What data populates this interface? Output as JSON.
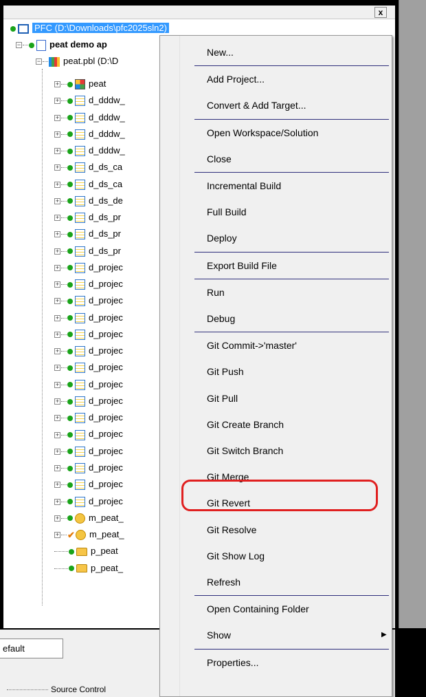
{
  "tree": {
    "workspace_label": "PFC (D:\\Downloads\\pfc2025sln2)",
    "target_label": "peat demo ap",
    "library_label": "peat.pbl (D:\\D",
    "items": [
      {
        "label": "peat",
        "icon": "application-icon",
        "status": "dot"
      },
      {
        "label": "d_dddw_",
        "icon": "datawindow-icon",
        "status": "dot"
      },
      {
        "label": "d_dddw_",
        "icon": "datawindow-icon",
        "status": "dot"
      },
      {
        "label": "d_dddw_",
        "icon": "datawindow-icon",
        "status": "dot"
      },
      {
        "label": "d_dddw_",
        "icon": "datawindow-icon",
        "status": "dot"
      },
      {
        "label": "d_ds_ca",
        "icon": "datawindow-icon",
        "status": "dot"
      },
      {
        "label": "d_ds_ca",
        "icon": "datawindow-icon",
        "status": "dot"
      },
      {
        "label": "d_ds_de",
        "icon": "datawindow-icon",
        "status": "dot"
      },
      {
        "label": "d_ds_pr",
        "icon": "datawindow-icon",
        "status": "dot"
      },
      {
        "label": "d_ds_pr",
        "icon": "datawindow-icon",
        "status": "dot"
      },
      {
        "label": "d_ds_pr",
        "icon": "datawindow-icon",
        "status": "dot"
      },
      {
        "label": "d_projec",
        "icon": "datawindow-icon",
        "status": "dot"
      },
      {
        "label": "d_projec",
        "icon": "datawindow-icon",
        "status": "dot"
      },
      {
        "label": "d_projec",
        "icon": "datawindow-icon",
        "status": "dot"
      },
      {
        "label": "d_projec",
        "icon": "datawindow-icon",
        "status": "dot"
      },
      {
        "label": "d_projec",
        "icon": "datawindow-icon",
        "status": "dot"
      },
      {
        "label": "d_projec",
        "icon": "datawindow-icon",
        "status": "dot"
      },
      {
        "label": "d_projec",
        "icon": "datawindow-icon",
        "status": "dot"
      },
      {
        "label": "d_projec",
        "icon": "datawindow-icon",
        "status": "dot"
      },
      {
        "label": "d_projec",
        "icon": "datawindow-icon",
        "status": "dot"
      },
      {
        "label": "d_projec",
        "icon": "datawindow-icon",
        "status": "dot"
      },
      {
        "label": "d_projec",
        "icon": "datawindow-icon",
        "status": "dot"
      },
      {
        "label": "d_projec",
        "icon": "datawindow-icon",
        "status": "dot"
      },
      {
        "label": "d_projec",
        "icon": "datawindow-icon",
        "status": "dot"
      },
      {
        "label": "d_projec",
        "icon": "datawindow-icon",
        "status": "dot"
      },
      {
        "label": "d_projec",
        "icon": "datawindow-icon",
        "status": "dot"
      },
      {
        "label": "m_peat_",
        "icon": "menu-icon",
        "status": "dot"
      },
      {
        "label": "m_peat_",
        "icon": "menu-icon",
        "status": "check"
      },
      {
        "label": "p_peat",
        "icon": "folder-icon",
        "status": "dot"
      },
      {
        "label": "p_peat_",
        "icon": "folder-icon",
        "status": "dot"
      }
    ]
  },
  "close_glyph": "x",
  "bottom": {
    "tab_label": "efault",
    "source_control_label": "Source Control"
  },
  "context_menu": {
    "items": [
      {
        "label": "New...",
        "sep_after": true
      },
      {
        "label": "Add Project...",
        "sep_after": false
      },
      {
        "label": "Convert & Add Target...",
        "sep_after": true
      },
      {
        "label": "Open Workspace/Solution",
        "sep_after": false
      },
      {
        "label": "Close",
        "sep_after": true
      },
      {
        "label": "Incremental Build",
        "sep_after": false
      },
      {
        "label": "Full Build",
        "sep_after": false
      },
      {
        "label": "Deploy",
        "sep_after": true
      },
      {
        "label": "Export Build File",
        "sep_after": true
      },
      {
        "label": "Run",
        "sep_after": false
      },
      {
        "label": "Debug",
        "sep_after": true
      },
      {
        "label": "Git Commit->'master'",
        "sep_after": false
      },
      {
        "label": "Git Push",
        "sep_after": false
      },
      {
        "label": "Git Pull",
        "sep_after": false
      },
      {
        "label": "Git Create Branch",
        "sep_after": false
      },
      {
        "label": "Git Switch Branch",
        "sep_after": false
      },
      {
        "label": "Git Merge",
        "sep_after": false,
        "highlighted": true
      },
      {
        "label": "Git Revert",
        "sep_after": false
      },
      {
        "label": "Git Resolve",
        "sep_after": false
      },
      {
        "label": "Git Show Log",
        "sep_after": false
      },
      {
        "label": "Refresh",
        "sep_after": true
      },
      {
        "label": "Open Containing  Folder",
        "sep_after": false
      },
      {
        "label": "Show",
        "sep_after": true,
        "has_submenu": true
      },
      {
        "label": "Properties...",
        "sep_after": false
      }
    ],
    "submenu_glyph": "▶"
  },
  "colors": {
    "selection": "#3399ff",
    "highlight_ring": "#e02020",
    "status_dot": "#1aa31a"
  }
}
